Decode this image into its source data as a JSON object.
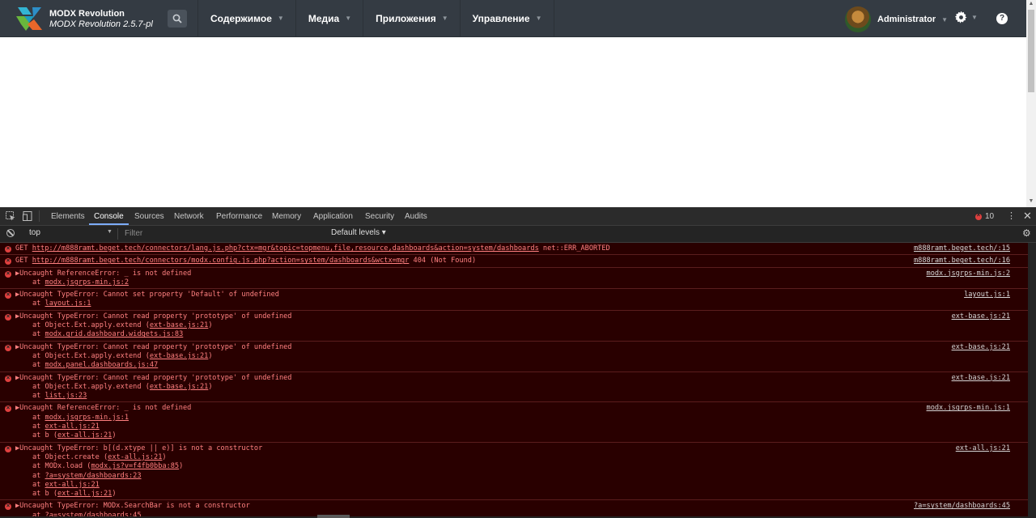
{
  "header": {
    "brand_name": "MODX Revolution",
    "brand_version": "MODX Revolution 2.5.7-pl",
    "nav": [
      {
        "label": "Содержимое"
      },
      {
        "label": "Медиа"
      },
      {
        "label": "Приложения"
      },
      {
        "label": "Управление"
      }
    ],
    "user": "Administrator",
    "help_label": "?",
    "icons": {
      "logo": "modx-logo-icon",
      "search": "search-icon",
      "settings": "gear-icon",
      "help": "help-icon"
    }
  },
  "devtools": {
    "tabs": [
      "Elements",
      "Console",
      "Sources",
      "Network",
      "Performance",
      "Memory",
      "Application",
      "Security",
      "Audits"
    ],
    "active_tab": "Console",
    "error_count": "10",
    "context": "top",
    "filter_placeholder": "Filter",
    "levels": "Default levels ▾",
    "accent_color": "#7cacf8",
    "error_color": "#ff8080"
  },
  "console": {
    "messages": [
      {
        "text": "GET ",
        "url": "http://m888ramt.beget.tech/connectors/lang.js.php?ctx=mgr&topic=topmenu,file,resource,dashboards&action=system/dashboards",
        "suffix": " net::ERR_ABORTED",
        "source": "m888ramt.beget.tech/:15",
        "stack": []
      },
      {
        "text": "GET ",
        "url": "http://m888ramt.beget.tech/connectors/modx.config.js.php?action=system/dashboards&wctx=mgr",
        "suffix": " 404 (Not Found)",
        "source": "m888ramt.beget.tech/:16",
        "stack": []
      },
      {
        "text": "▶Uncaught ReferenceError: _ is not defined",
        "source": "modx.jsgrps-min.js:2",
        "stack": [
          {
            "pre": "at ",
            "link": "modx.jsgrps-min.js:2",
            "post": ""
          }
        ]
      },
      {
        "text": "▶Uncaught TypeError: Cannot set property 'Default' of undefined",
        "source": "layout.js:1",
        "stack": [
          {
            "pre": "at ",
            "link": "layout.js:1",
            "post": ""
          }
        ]
      },
      {
        "text": "▶Uncaught TypeError: Cannot read property 'prototype' of undefined",
        "source": "ext-base.js:21",
        "stack": [
          {
            "pre": "at Object.Ext.apply.extend (",
            "link": "ext-base.js:21",
            "post": ")"
          },
          {
            "pre": "at ",
            "link": "modx.grid.dashboard.widgets.js:83",
            "post": ""
          }
        ]
      },
      {
        "text": "▶Uncaught TypeError: Cannot read property 'prototype' of undefined",
        "source": "ext-base.js:21",
        "stack": [
          {
            "pre": "at Object.Ext.apply.extend (",
            "link": "ext-base.js:21",
            "post": ")"
          },
          {
            "pre": "at ",
            "link": "modx.panel.dashboards.js:47",
            "post": ""
          }
        ]
      },
      {
        "text": "▶Uncaught TypeError: Cannot read property 'prototype' of undefined",
        "source": "ext-base.js:21",
        "stack": [
          {
            "pre": "at Object.Ext.apply.extend (",
            "link": "ext-base.js:21",
            "post": ")"
          },
          {
            "pre": "at ",
            "link": "list.js:23",
            "post": ""
          }
        ]
      },
      {
        "text": "▶Uncaught ReferenceError: _ is not defined",
        "source": "modx.jsgrps-min.js:1",
        "stack": [
          {
            "pre": "at ",
            "link": "modx.jsgrps-min.js:1",
            "post": ""
          },
          {
            "pre": "at ",
            "link": "ext-all.js:21",
            "post": ""
          },
          {
            "pre": "at b (",
            "link": "ext-all.js:21",
            "post": ")"
          }
        ]
      },
      {
        "text": "▶Uncaught TypeError: b[(d.xtype || e)] is not a constructor",
        "source": "ext-all.js:21",
        "stack": [
          {
            "pre": "at Object.create (",
            "link": "ext-all.js:21",
            "post": ")"
          },
          {
            "pre": "at MODx.load (",
            "link": "modx.js?v=f4fb0bba:85",
            "post": ")"
          },
          {
            "pre": "at ",
            "link": "?a=system/dashboards:23",
            "post": ""
          },
          {
            "pre": "at ",
            "link": "ext-all.js:21",
            "post": ""
          },
          {
            "pre": "at b (",
            "link": "ext-all.js:21",
            "post": ")"
          }
        ]
      },
      {
        "text": "▶Uncaught TypeError: MODx.SearchBar is not a constructor",
        "source": "?a=system/dashboards:45",
        "stack": [
          {
            "pre": "at ",
            "link": "?a=system/dashboards:45",
            "post": ""
          }
        ]
      }
    ]
  }
}
